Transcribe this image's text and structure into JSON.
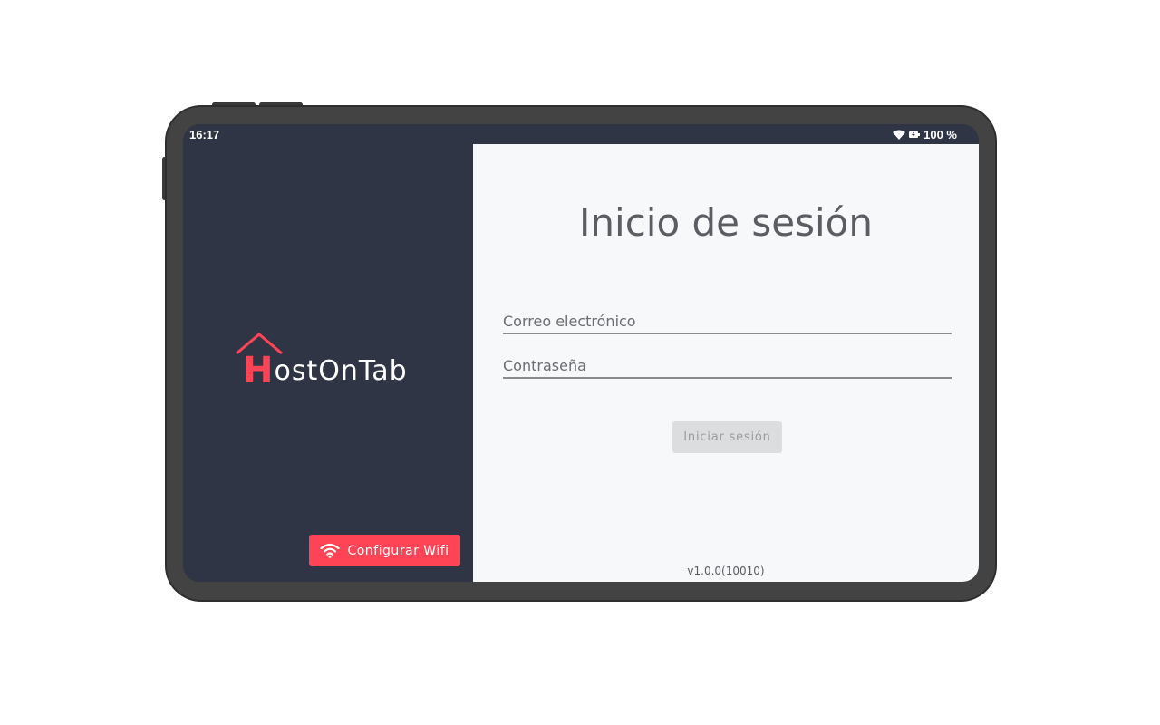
{
  "status_bar": {
    "time": "16:17",
    "battery": "100 %",
    "icons": [
      "wifi-icon",
      "battery-icon"
    ]
  },
  "brand": {
    "logo_first_letter": "H",
    "logo_rest": "ostOnTab",
    "accent_color": "#ff4456",
    "logo_icon": "house-roof-icon"
  },
  "left_panel": {
    "wifi_button_label": "Configurar Wifi",
    "wifi_button_icon": "wifi-icon"
  },
  "login": {
    "title": "Inicio de sesión",
    "email_placeholder": "Correo electrónico",
    "password_placeholder": "Contraseña",
    "submit_label": "Iniciar sesión",
    "version": "v1.0.0(10010)"
  }
}
